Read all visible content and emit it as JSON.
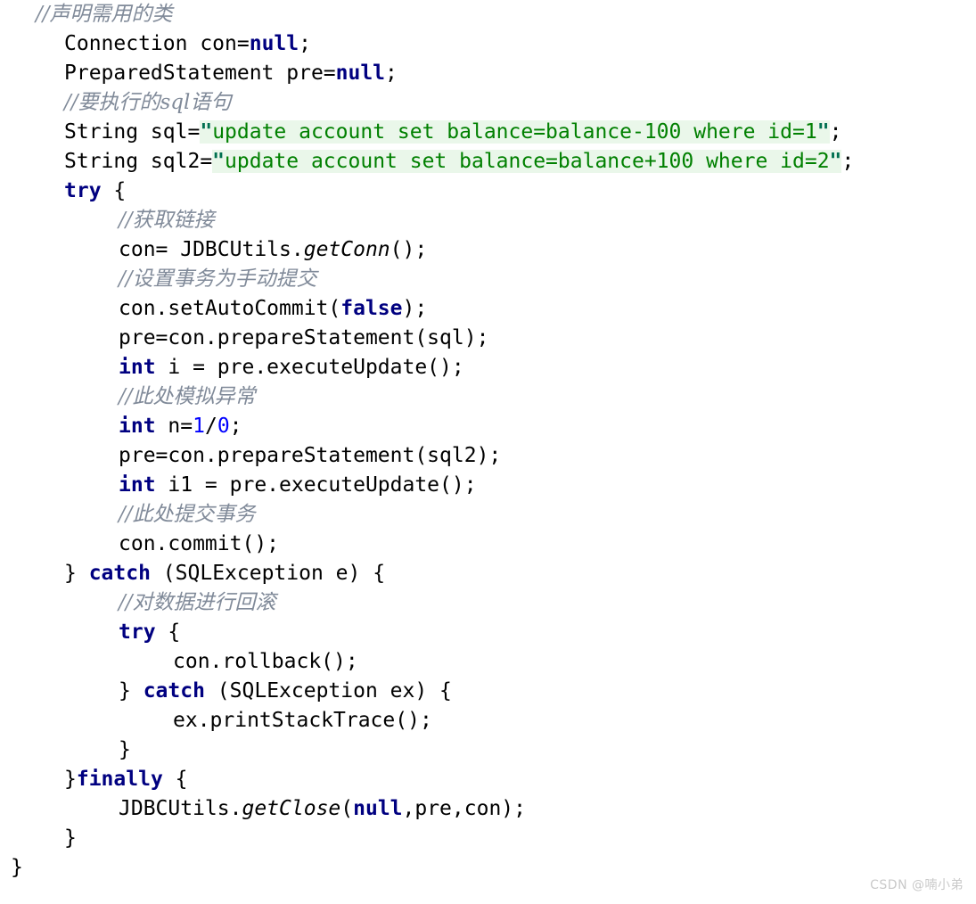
{
  "watermark": "CSDN @喃小弟",
  "code": {
    "language": "java",
    "lines": [
      {
        "indent": 40,
        "tokens": [
          {
            "t": "//声明需用的类",
            "c": "cmt"
          }
        ]
      },
      {
        "indent": 72,
        "tokens": [
          {
            "t": "Connection con=",
            "c": "pln"
          },
          {
            "t": "null",
            "c": "kw"
          },
          {
            "t": ";",
            "c": "pln"
          }
        ]
      },
      {
        "indent": 72,
        "tokens": [
          {
            "t": "PreparedStatement pre=",
            "c": "pln"
          },
          {
            "t": "null",
            "c": "kw"
          },
          {
            "t": ";",
            "c": "pln"
          }
        ]
      },
      {
        "indent": 72,
        "tokens": [
          {
            "t": "//要执行的sql语句",
            "c": "cmt"
          }
        ]
      },
      {
        "indent": 72,
        "tokens": [
          {
            "t": "String sql=",
            "c": "pln"
          },
          {
            "t": "\"",
            "c": "strq"
          },
          {
            "t": "update account set balance=balance-100 where id=1",
            "c": "str"
          },
          {
            "t": "\"",
            "c": "strq"
          },
          {
            "t": ";",
            "c": "pln"
          }
        ]
      },
      {
        "indent": 72,
        "tokens": [
          {
            "t": "String sql2=",
            "c": "pln"
          },
          {
            "t": "\"",
            "c": "strq"
          },
          {
            "t": "update account set balance=balance+100 where id=2",
            "c": "str"
          },
          {
            "t": "\"",
            "c": "strq"
          },
          {
            "t": ";",
            "c": "pln"
          }
        ]
      },
      {
        "indent": 72,
        "tokens": [
          {
            "t": "try",
            "c": "kw"
          },
          {
            "t": " {",
            "c": "pln"
          }
        ]
      },
      {
        "indent": 133,
        "tokens": [
          {
            "t": "//获取链接",
            "c": "cmt"
          }
        ]
      },
      {
        "indent": 133,
        "tokens": [
          {
            "t": "con= JDBCUtils.",
            "c": "pln"
          },
          {
            "t": "getConn",
            "c": "mth"
          },
          {
            "t": "();",
            "c": "pln"
          }
        ]
      },
      {
        "indent": 133,
        "tokens": [
          {
            "t": "//设置事务为手动提交",
            "c": "cmt"
          }
        ]
      },
      {
        "indent": 133,
        "tokens": [
          {
            "t": "con.setAutoCommit(",
            "c": "pln"
          },
          {
            "t": "false",
            "c": "kw"
          },
          {
            "t": ");",
            "c": "pln"
          }
        ]
      },
      {
        "indent": 133,
        "tokens": [
          {
            "t": "pre=con.prepareStatement(sql);",
            "c": "pln"
          }
        ]
      },
      {
        "indent": 133,
        "tokens": [
          {
            "t": "int",
            "c": "kw"
          },
          {
            "t": " i = pre.executeUpdate();",
            "c": "pln"
          }
        ]
      },
      {
        "indent": 133,
        "tokens": [
          {
            "t": "//此处模拟异常",
            "c": "cmt"
          }
        ]
      },
      {
        "indent": 133,
        "tokens": [
          {
            "t": "int",
            "c": "kw"
          },
          {
            "t": " n=",
            "c": "pln"
          },
          {
            "t": "1",
            "c": "num"
          },
          {
            "t": "/",
            "c": "pln"
          },
          {
            "t": "0",
            "c": "num"
          },
          {
            "t": ";",
            "c": "pln"
          }
        ]
      },
      {
        "indent": 133,
        "tokens": [
          {
            "t": "pre=con.prepareStatement(sql2);",
            "c": "pln"
          }
        ]
      },
      {
        "indent": 133,
        "tokens": [
          {
            "t": "int",
            "c": "kw"
          },
          {
            "t": " i1 = pre.executeUpdate();",
            "c": "pln"
          }
        ]
      },
      {
        "indent": 133,
        "tokens": [
          {
            "t": "//此处提交事务",
            "c": "cmt"
          }
        ]
      },
      {
        "indent": 133,
        "tokens": [
          {
            "t": "con.commit();",
            "c": "pln"
          }
        ]
      },
      {
        "indent": 72,
        "tokens": [
          {
            "t": "} ",
            "c": "pln"
          },
          {
            "t": "catch",
            "c": "kw"
          },
          {
            "t": " (SQLException e) {",
            "c": "pln"
          }
        ]
      },
      {
        "indent": 133,
        "tokens": [
          {
            "t": "//对数据进行回滚",
            "c": "cmt"
          }
        ]
      },
      {
        "indent": 133,
        "tokens": [
          {
            "t": "try",
            "c": "kw"
          },
          {
            "t": " {",
            "c": "pln"
          }
        ]
      },
      {
        "indent": 194,
        "tokens": [
          {
            "t": "con.rollback();",
            "c": "pln"
          }
        ]
      },
      {
        "indent": 133,
        "tokens": [
          {
            "t": "} ",
            "c": "pln"
          },
          {
            "t": "catch",
            "c": "kw"
          },
          {
            "t": " (SQLException ex) {",
            "c": "pln"
          }
        ]
      },
      {
        "indent": 194,
        "tokens": [
          {
            "t": "ex.printStackTrace();",
            "c": "pln"
          }
        ]
      },
      {
        "indent": 133,
        "tokens": [
          {
            "t": "}",
            "c": "pln"
          }
        ]
      },
      {
        "indent": 72,
        "tokens": [
          {
            "t": "}",
            "c": "pln"
          },
          {
            "t": "finally",
            "c": "kw"
          },
          {
            "t": " {",
            "c": "pln"
          }
        ]
      },
      {
        "indent": 133,
        "tokens": [
          {
            "t": "JDBCUtils.",
            "c": "pln"
          },
          {
            "t": "getClose",
            "c": "mth"
          },
          {
            "t": "(",
            "c": "pln"
          },
          {
            "t": "null",
            "c": "kw"
          },
          {
            "t": ",pre,con);",
            "c": "pln"
          }
        ]
      },
      {
        "indent": 72,
        "tokens": [
          {
            "t": "}",
            "c": "pln"
          }
        ]
      },
      {
        "indent": 12,
        "tokens": [
          {
            "t": "}",
            "c": "pln"
          }
        ]
      }
    ]
  }
}
